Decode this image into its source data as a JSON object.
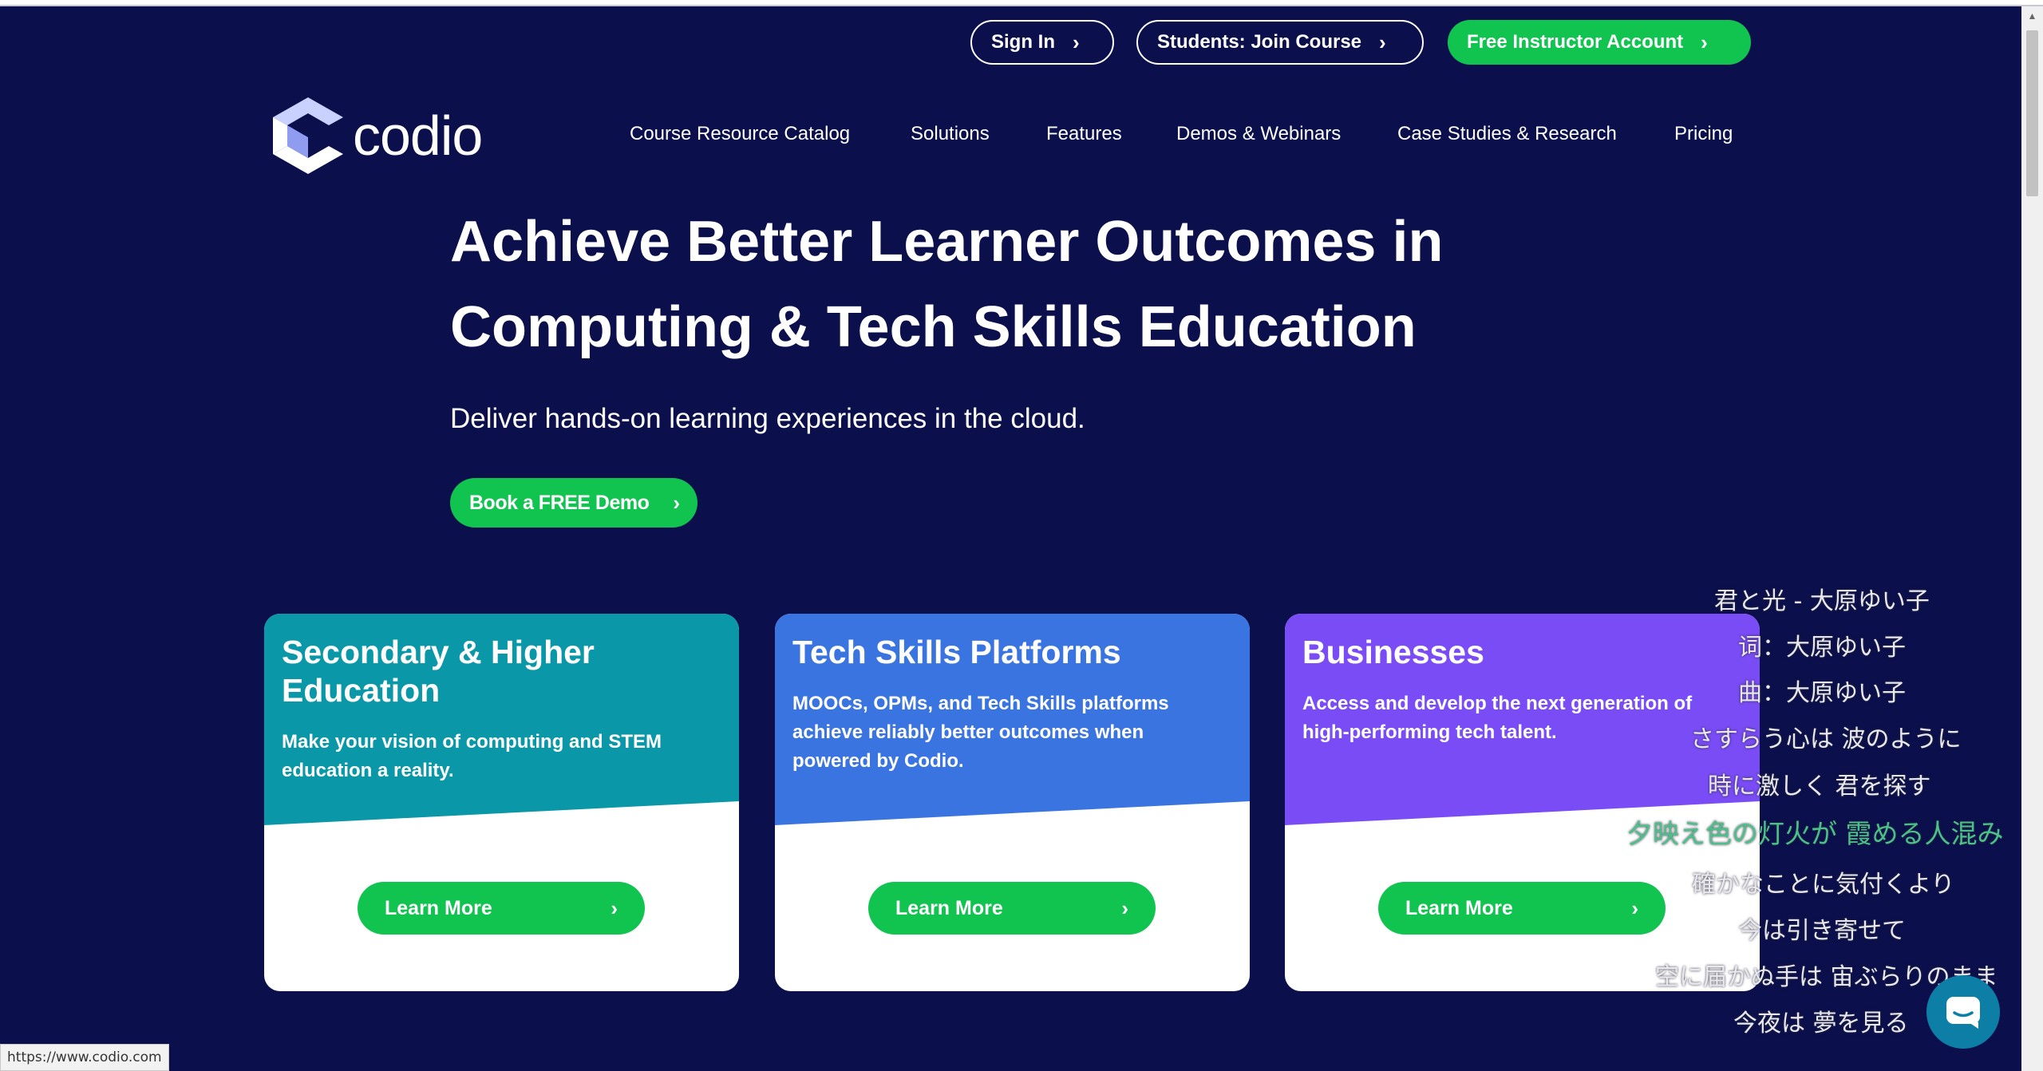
{
  "header": {
    "sign_in": "Sign In",
    "join_course": "Students: Join Course",
    "free_account": "Free Instructor Account"
  },
  "logo": {
    "text": "codio"
  },
  "nav": {
    "items": [
      "Course Resource Catalog",
      "Solutions",
      "Features",
      "Demos & Webinars",
      "Case Studies & Research",
      "Pricing"
    ]
  },
  "hero": {
    "title_line1": "Achieve Better Learner Outcomes in",
    "title_line2": "Computing & Tech Skills Education",
    "subtitle": "Deliver hands-on learning experiences in the cloud.",
    "cta": "Book a FREE Demo"
  },
  "cards": [
    {
      "title": "Secondary & Higher Education",
      "description": "Make your vision of computing and STEM education a reality.",
      "button": "Learn More",
      "color": "#0a98a8"
    },
    {
      "title": "Tech Skills Platforms",
      "description": "MOOCs, OPMs, and Tech Skills platforms achieve reliably better outcomes when powered by Codio.",
      "button": "Learn More",
      "color": "#3a74e0"
    },
    {
      "title": "Businesses",
      "description": "Access and develop the next generation of high-performing tech talent.",
      "button": "Learn More",
      "color": "#7a4cf5"
    }
  ],
  "lyrics": [
    "君と光 - 大原ゆい子",
    "词：大原ゆい子",
    "曲：大原ゆい子",
    "さすらう心は 波のように",
    "時に激しく 君を探す",
    "夕映え色の灯火が 霞める人混み",
    "確かなことに気付くより",
    "今は引き寄せて",
    "空に届かぬ手は 宙ぶらりのまま",
    "今夜は 夢を見る"
  ],
  "status_bar": {
    "url": "https://www.codio.com"
  },
  "colors": {
    "background": "#0b0f4b",
    "accent_green": "#11c44f"
  },
  "icons": [
    "chevron-right-icon",
    "codio-logo-icon",
    "chat-icon"
  ]
}
